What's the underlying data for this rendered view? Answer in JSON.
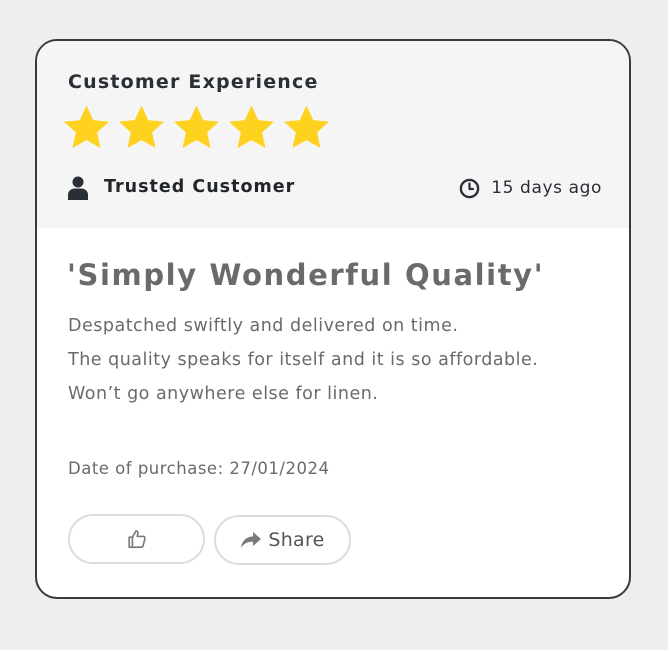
{
  "header": {
    "title": "Customer Experience",
    "rating": 5,
    "rating_max": 5,
    "star_color": "#FFD21F",
    "reviewer_label": "Trusted Customer",
    "reviewer_icon": "user-icon",
    "time_icon": "clock-icon",
    "time_ago": "15 days ago"
  },
  "review": {
    "title": "'Simply Wonderful Quality'",
    "body_lines": [
      "Despatched swiftly and delivered on time.",
      "The quality speaks for itself and it is so affordable.",
      "Won’t go anywhere else for linen."
    ],
    "purchase_date": "Date of purchase: 27/01/2024"
  },
  "actions": {
    "like_icon": "thumbs-up-icon",
    "share_icon": "share-arrow-icon",
    "share_label": "Share"
  },
  "colors": {
    "header_bg": "#F5F5F5",
    "card_border": "#3A3A3A",
    "text_dark": "#2A2F36",
    "text_muted": "#6A6A6A",
    "button_border": "#DCDCDC"
  }
}
